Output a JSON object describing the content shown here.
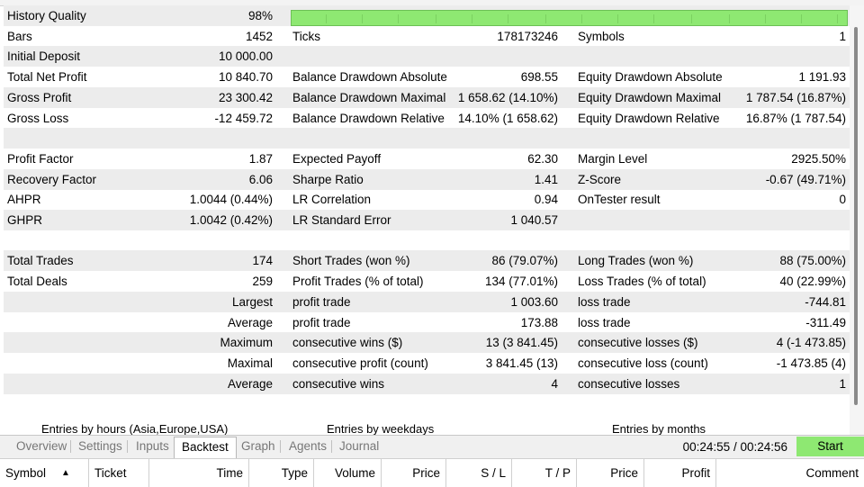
{
  "report": {
    "history_quality": {
      "label": "History Quality",
      "value": "98%",
      "fill": 0.98
    },
    "rows": [
      {
        "l1": "Bars",
        "v1": "1452",
        "l2": "Ticks",
        "v2": "178173246",
        "l3": "Symbols",
        "v3": "1"
      },
      {
        "l1": "Initial Deposit",
        "v1": "10 000.00",
        "l2": "",
        "v2": "",
        "l3": "",
        "v3": ""
      },
      {
        "l1": "Total Net Profit",
        "v1": "10 840.70",
        "l2": "Balance Drawdown Absolute",
        "v2": "698.55",
        "l3": "Equity Drawdown Absolute",
        "v3": "1 191.93"
      },
      {
        "l1": "Gross Profit",
        "v1": "23 300.42",
        "l2": "Balance Drawdown Maximal",
        "v2": "1 658.62 (14.10%)",
        "l3": "Equity Drawdown Maximal",
        "v3": "1 787.54 (16.87%)"
      },
      {
        "l1": "Gross Loss",
        "v1": "-12 459.72",
        "l2": "Balance Drawdown Relative",
        "v2": "14.10% (1 658.62)",
        "l3": "Equity Drawdown Relative",
        "v3": "16.87% (1 787.54)"
      },
      {
        "l1": "",
        "v1": "",
        "l2": "",
        "v2": "",
        "l3": "",
        "v3": ""
      },
      {
        "l1": "Profit Factor",
        "v1": "1.87",
        "l2": "Expected Payoff",
        "v2": "62.30",
        "l3": "Margin Level",
        "v3": "2925.50%"
      },
      {
        "l1": "Recovery Factor",
        "v1": "6.06",
        "l2": "Sharpe Ratio",
        "v2": "1.41",
        "l3": "Z-Score",
        "v3": "-0.67 (49.71%)"
      },
      {
        "l1": "AHPR",
        "v1": "1.0044 (0.44%)",
        "l2": "LR Correlation",
        "v2": "0.94",
        "l3": "OnTester result",
        "v3": "0"
      },
      {
        "l1": "GHPR",
        "v1": "1.0042 (0.42%)",
        "l2": "LR Standard Error",
        "v2": "1 040.57",
        "l3": "",
        "v3": ""
      },
      {
        "l1": "",
        "v1": "",
        "l2": "",
        "v2": "",
        "l3": "",
        "v3": ""
      },
      {
        "l1": "Total Trades",
        "v1": "174",
        "l2": "Short Trades (won %)",
        "v2": "86 (79.07%)",
        "l3": "Long Trades (won %)",
        "v3": "88 (75.00%)"
      },
      {
        "l1": "Total Deals",
        "v1": "259",
        "l2": "Profit Trades (% of total)",
        "v2": "134 (77.01%)",
        "l3": "Loss Trades (% of total)",
        "v3": "40 (22.99%)"
      },
      {
        "l1": "",
        "v1": "Largest",
        "l2": "profit trade",
        "v2": "1 003.60",
        "l3": "loss trade",
        "v3": "-744.81"
      },
      {
        "l1": "",
        "v1": "Average",
        "l2": "profit trade",
        "v2": "173.88",
        "l3": "loss trade",
        "v3": "-311.49"
      },
      {
        "l1": "",
        "v1": "Maximum",
        "l2": "consecutive wins ($)",
        "v2": "13 (3 841.45)",
        "l3": "consecutive losses ($)",
        "v3": "4 (-1 473.85)"
      },
      {
        "l1": "",
        "v1": "Maximal",
        "l2": "consecutive profit (count)",
        "v2": "3 841.45 (13)",
        "l3": "consecutive loss (count)",
        "v3": "-1 473.85 (4)"
      },
      {
        "l1": "",
        "v1": "Average",
        "l2": "consecutive wins",
        "v2": "4",
        "l3": "consecutive losses",
        "v3": "1"
      },
      {
        "l1": "",
        "v1": "",
        "l2": "",
        "v2": "",
        "l3": "",
        "v3": ""
      }
    ],
    "section_labels": {
      "hours": "Entries by hours (Asia,Europe,USA)",
      "weekdays": "Entries by weekdays",
      "months": "Entries by months"
    }
  },
  "tabs": [
    "Overview",
    "Settings",
    "Inputs",
    "Backtest",
    "Graph",
    "Agents",
    "Journal"
  ],
  "active_tab": "Backtest",
  "timer": "00:24:55 / 00:24:56",
  "start_label": "Start",
  "columns": [
    "Symbol",
    "Ticket",
    "Time",
    "Type",
    "Volume",
    "Price",
    "S / L",
    "T / P",
    "Price",
    "Profit",
    "Comment"
  ],
  "sort_indicator": "▲",
  "colors": {
    "accent_green": "#8ee872",
    "row_shade": "#ececec"
  }
}
